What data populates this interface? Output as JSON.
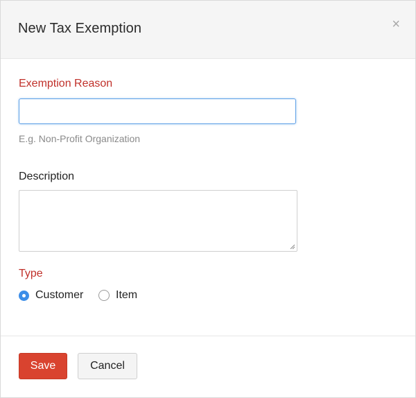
{
  "dialog": {
    "title": "New Tax Exemption",
    "close_symbol": "×"
  },
  "form": {
    "exemption_reason": {
      "label": "Exemption Reason",
      "value": "",
      "hint": "E.g. Non-Profit Organization"
    },
    "description": {
      "label": "Description",
      "value": ""
    },
    "type": {
      "label": "Type",
      "options": [
        {
          "label": "Customer",
          "selected": true
        },
        {
          "label": "Item",
          "selected": false
        }
      ]
    }
  },
  "footer": {
    "save_label": "Save",
    "cancel_label": "Cancel"
  },
  "colors": {
    "required_label": "#c0302a",
    "primary_button": "#d9432f",
    "radio_selected": "#3d8ee8",
    "input_focus_border": "#5c9fe6"
  }
}
